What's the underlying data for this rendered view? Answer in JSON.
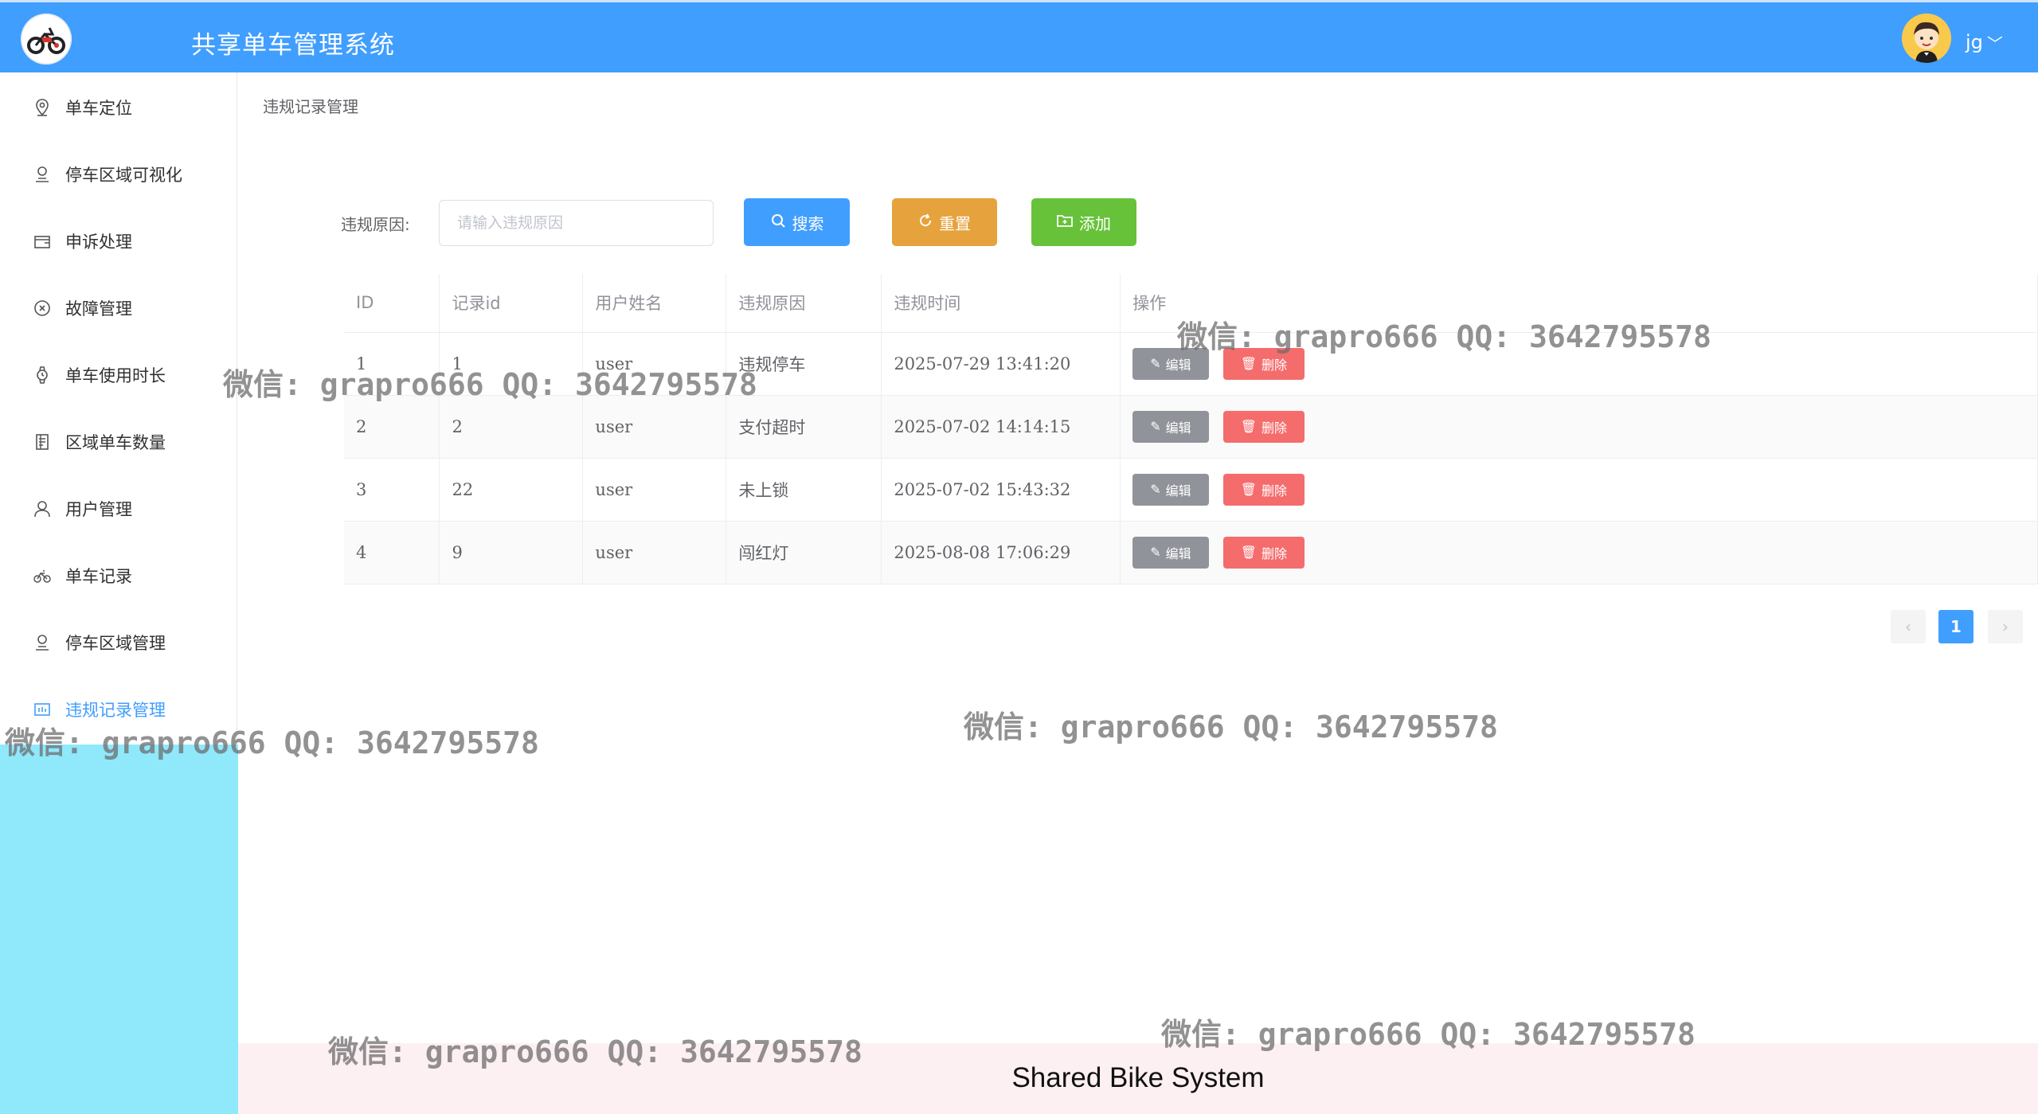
{
  "header": {
    "title": "共享单车管理系统",
    "user": "jg",
    "caret": "﹀"
  },
  "sidebar": {
    "items": [
      {
        "label": "单车定位",
        "icon": "location-icon"
      },
      {
        "label": "停车区域可视化",
        "icon": "user-pin-icon"
      },
      {
        "label": "申诉处理",
        "icon": "wallet-icon"
      },
      {
        "label": "故障管理",
        "icon": "circle-close-icon"
      },
      {
        "label": "单车使用时长",
        "icon": "watch-icon"
      },
      {
        "label": "区域单车数量",
        "icon": "tickets-icon"
      },
      {
        "label": "用户管理",
        "icon": "user-icon"
      },
      {
        "label": "单车记录",
        "icon": "bicycle-icon"
      },
      {
        "label": "停车区域管理",
        "icon": "user-pin-icon"
      },
      {
        "label": "违规记录管理",
        "icon": "data-board-icon"
      }
    ]
  },
  "breadcrumb": "违规记录管理",
  "search": {
    "label": "违规原因:",
    "placeholder": "请输入违规原因",
    "search_label": "搜索",
    "reset_label": "重置",
    "add_label": "添加"
  },
  "table": {
    "columns": [
      "ID",
      "记录id",
      "用户姓名",
      "违规原因",
      "违规时间",
      "操作"
    ],
    "rows": [
      {
        "id": "1",
        "record_id": "1",
        "user": "user",
        "reason": "违规停车",
        "time": "2025-07-29 13:41:20"
      },
      {
        "id": "2",
        "record_id": "2",
        "user": "user",
        "reason": "支付超时",
        "time": "2025-07-02 14:14:15"
      },
      {
        "id": "3",
        "record_id": "22",
        "user": "user",
        "reason": "未上锁",
        "time": "2025-07-02 15:43:32"
      },
      {
        "id": "4",
        "record_id": "9",
        "user": "user",
        "reason": "闯红灯",
        "time": "2025-08-08 17:06:29"
      }
    ],
    "edit_label": "编辑",
    "delete_label": "删除"
  },
  "pagination": {
    "prev": "‹",
    "current": "1",
    "next": "›"
  },
  "footer": "Shared Bike System",
  "watermark": "微信: grapro666 QQ: 3642795578",
  "colors": {
    "primary": "#409eff",
    "warning": "#e6a23c",
    "success": "#67c23a",
    "danger": "#f56c6c",
    "info": "#909399"
  }
}
